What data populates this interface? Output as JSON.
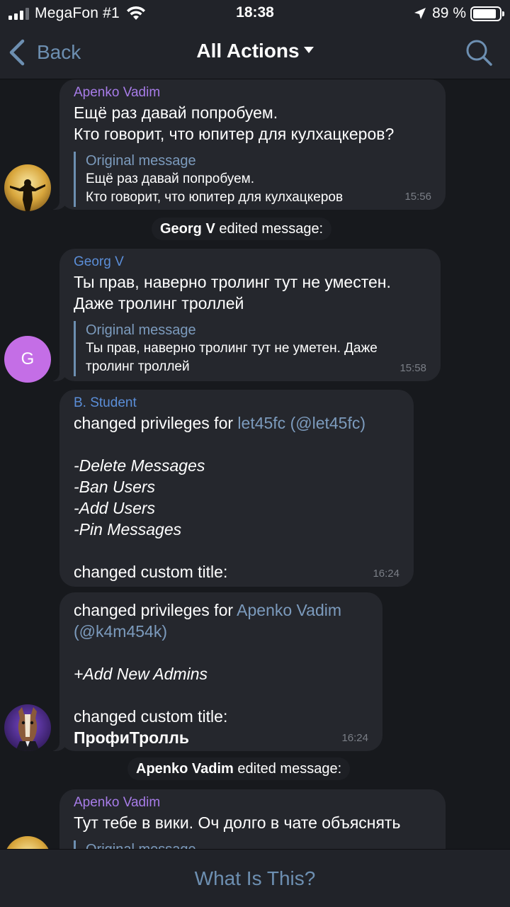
{
  "status_bar": {
    "carrier": "MegaFon #1",
    "time": "18:38",
    "battery": "89 %",
    "battery_level": 0.89,
    "icons": [
      "signal-icon",
      "wifi-icon",
      "location-icon",
      "battery-icon"
    ]
  },
  "nav": {
    "back_label": "Back",
    "title": "All Actions",
    "icons": [
      "back-chevron-icon",
      "dropdown-caret-icon",
      "search-icon"
    ]
  },
  "messages": [
    {
      "sender": "Apenko Vadim",
      "text_line1": "Ещё раз давай попробуем.",
      "text_line2": "Кто говорит, что юпитер для кулхацкеров?",
      "orig_title": "Original message",
      "orig_line1": "Ещё раз давай попробуем.",
      "orig_line2": "Кто говорит, что юпитер для кулхацкеров",
      "time": "15:56"
    },
    {
      "service_actor": "Georg V",
      "service_text": "edited message:"
    },
    {
      "sender": "Georg V",
      "avatar_letter": "G",
      "text_line1": "Ты прав, наверно тролинг тут не уместен.",
      "text_line2": "Даже тролинг троллей",
      "orig_title": "Original message",
      "orig_line1": "Ты прав, наверно тролинг тут не уметен. Даже",
      "orig_line2": "тролинг троллей",
      "time": "15:58"
    },
    {
      "sender": "B. Student",
      "intro": "changed privileges for ",
      "target_name": "let45fc",
      "target_username": "@let45fc",
      "privileges": [
        "-Delete Messages",
        "-Ban Users",
        "-Add Users",
        "-Pin Messages"
      ],
      "custom_title_label": "changed custom title:",
      "time": "16:24"
    },
    {
      "intro": "changed privileges for ",
      "target_name": "Apenko Vadim",
      "target_username": "@k4m454k",
      "privileges": [
        "+Add New Admins"
      ],
      "custom_title_label": "changed custom title:",
      "custom_title": "ПрофиТролль",
      "time": "16:24"
    },
    {
      "service_actor": "Apenko Vadim",
      "service_text": "edited message:"
    },
    {
      "sender": "Apenko Vadim",
      "text_line1": "Тут тебе в вики. Оч долго в чате объяснять",
      "orig_title": "Original message"
    }
  ],
  "bottom": {
    "button_label": "What Is This?"
  },
  "colors": {
    "background": "#17191d",
    "bubble": "#25272d",
    "bar": "#212329",
    "accent": "#6d8fb1",
    "sender_purple": "#a77ce8",
    "sender_blue": "#5b8ed8",
    "avatar_g": "#c46ee6"
  }
}
